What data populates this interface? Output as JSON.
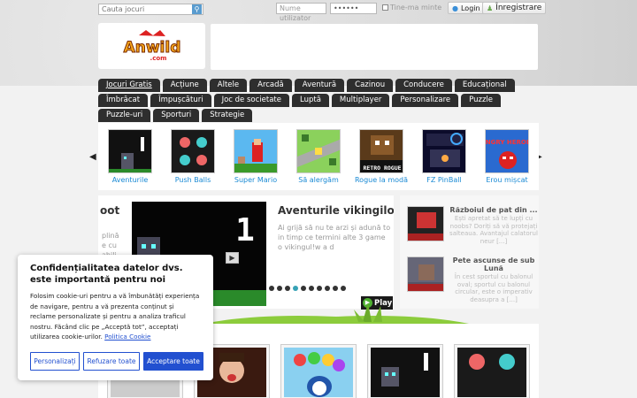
{
  "topbar": {
    "search_placeholder": "Cauta jocuri",
    "username_placeholder": "Nume utilizator",
    "password_value": "••••••",
    "remember_label": "Tine-ma minte",
    "login_label": "Login",
    "register_label": "Înregistrare"
  },
  "logo": {
    "text": "Anwild",
    "sub": ".com"
  },
  "menu": {
    "row1": [
      "Jocuri Gratis",
      "Acțiune",
      "Altele",
      "Arcadă",
      "Aventură",
      "Cazinou",
      "Conducere",
      "Educațional"
    ],
    "row2": [
      "Îmbrăcat",
      "Împușcături",
      "Joc de societate",
      "Luptă",
      "Multiplayer",
      "Personalizare",
      "Puzzle"
    ],
    "row3": [
      "Puzzle-uri",
      "Sporturi",
      "Strategie"
    ]
  },
  "carousel": {
    "items": [
      {
        "label": "Aventurile"
      },
      {
        "label": "Push Balls"
      },
      {
        "label": "Super Mario"
      },
      {
        "label": "Să alergăm"
      },
      {
        "label": "Rogue la modă"
      },
      {
        "label": "FZ PinBall"
      },
      {
        "label": "Erou mișcat"
      }
    ],
    "retro_text": "RETRO ROGUE",
    "angry_text": "ANGRY HEROES"
  },
  "featured": {
    "prev_title": "oot",
    "prev_desc": [
      "plină",
      "e cu",
      "abili"
    ],
    "title": "Aventurile vikingilor",
    "desc": "Ai grijă să nu te arzi și adună to in timp ce termini alte 3 game o vikingul!w a d",
    "play_label": "Play",
    "slide_number": "1"
  },
  "side": {
    "items": [
      {
        "title": "Războiul de pat din ...",
        "desc": "Ești apretat să te lupți cu noobs? Doriți să vă protejați salteaua. Avantajul calatorul neur [...]"
      },
      {
        "title": "Pete ascunse de sub Lună",
        "desc": "În cest sportul cu balonul oval; sportul cu balonul circular, este o imperativ deasupra a [...]"
      }
    ]
  },
  "cookie": {
    "title": "Confidențialitatea datelor dvs. este importantă pentru noi",
    "body": "Folosim cookie-uri pentru a vă îmbunătăți experiența de navigare, pentru a vă prezenta conținut și reclame personalizate și pentru a analiza traficul nostru. Făcând clic pe „Acceptă tot”, acceptați utilizarea cookie-urilor.",
    "policy_link": "Politica Cookie",
    "btn_customize": "Personalizați",
    "btn_reject": "Refuzare toate",
    "btn_accept": "Acceptare toate"
  }
}
